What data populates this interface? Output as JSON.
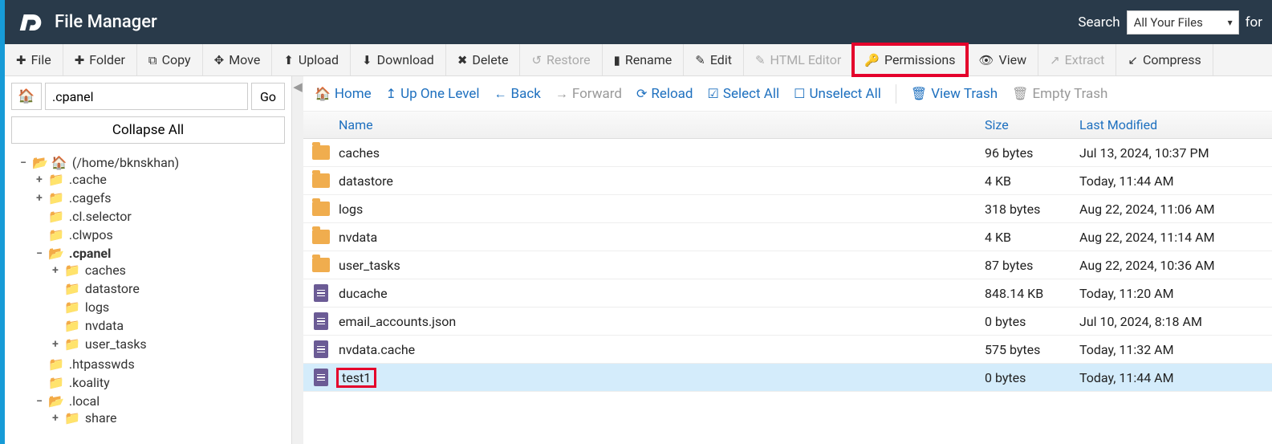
{
  "header": {
    "title": "File Manager",
    "search_label": "Search",
    "search_selected": "All Your Files",
    "for_label": "for"
  },
  "toolbar": {
    "file": "File",
    "folder": "Folder",
    "copy": "Copy",
    "move": "Move",
    "upload": "Upload",
    "download": "Download",
    "delete": "Delete",
    "restore": "Restore",
    "rename": "Rename",
    "edit": "Edit",
    "html_editor": "HTML Editor",
    "permissions": "Permissions",
    "view": "View",
    "extract": "Extract",
    "compress": "Compress"
  },
  "left": {
    "path_value": ".cpanel",
    "go": "Go",
    "collapse_all": "Collapse All",
    "root_label": "(/home/bknskhan)",
    "tree": [
      {
        "exp": "+",
        "label": ".cache"
      },
      {
        "exp": "+",
        "label": ".cagefs"
      },
      {
        "exp": "",
        "label": ".cl.selector"
      },
      {
        "exp": "",
        "label": ".clwpos"
      },
      {
        "exp": "−",
        "label": ".cpanel",
        "bold": true,
        "children": [
          {
            "exp": "+",
            "label": "caches"
          },
          {
            "exp": "",
            "label": "datastore"
          },
          {
            "exp": "",
            "label": "logs"
          },
          {
            "exp": "",
            "label": "nvdata"
          },
          {
            "exp": "+",
            "label": "user_tasks"
          }
        ]
      },
      {
        "exp": "",
        "label": ".htpasswds"
      },
      {
        "exp": "",
        "label": ".koality"
      },
      {
        "exp": "−",
        "label": ".local",
        "children": [
          {
            "exp": "+",
            "label": "share"
          }
        ]
      }
    ]
  },
  "navbar": {
    "home": "Home",
    "up_one_level": "Up One Level",
    "back": "Back",
    "forward": "Forward",
    "reload": "Reload",
    "select_all": "Select All",
    "unselect_all": "Unselect All",
    "view_trash": "View Trash",
    "empty_trash": "Empty Trash"
  },
  "table": {
    "headers": {
      "name": "Name",
      "size": "Size",
      "modified": "Last Modified"
    },
    "rows": [
      {
        "type": "folder",
        "name": "caches",
        "size": "96 bytes",
        "modified": "Jul 13, 2024, 10:37 PM"
      },
      {
        "type": "folder",
        "name": "datastore",
        "size": "4 KB",
        "modified": "Today, 11:44 AM"
      },
      {
        "type": "folder",
        "name": "logs",
        "size": "318 bytes",
        "modified": "Aug 22, 2024, 11:06 AM"
      },
      {
        "type": "folder",
        "name": "nvdata",
        "size": "4 KB",
        "modified": "Aug 22, 2024, 11:14 AM"
      },
      {
        "type": "folder",
        "name": "user_tasks",
        "size": "87 bytes",
        "modified": "Aug 22, 2024, 10:36 AM"
      },
      {
        "type": "file",
        "name": "ducache",
        "size": "848.14 KB",
        "modified": "Today, 11:20 AM"
      },
      {
        "type": "file",
        "name": "email_accounts.json",
        "size": "0 bytes",
        "modified": "Jul 10, 2024, 8:18 AM"
      },
      {
        "type": "file",
        "name": "nvdata.cache",
        "size": "575 bytes",
        "modified": "Today, 11:32 AM"
      },
      {
        "type": "file",
        "name": "test1",
        "size": "0 bytes",
        "modified": "Today, 11:44 AM",
        "selected": true
      }
    ]
  }
}
